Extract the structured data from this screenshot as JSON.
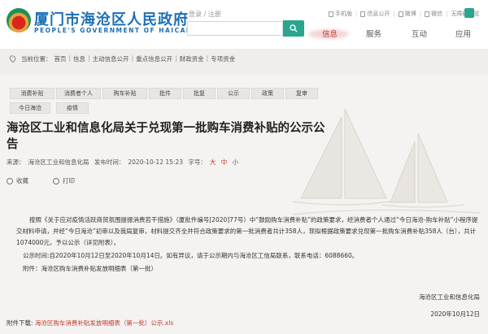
{
  "header": {
    "site_name_cn": "厦门市海沧区人民政府",
    "site_name_en": "PEOPLE'S GOVERNMENT OF HAICANG XIAMEN",
    "login_links": "登录 / 注册",
    "search": {
      "placeholder": ""
    },
    "utility": [
      "手机版",
      "信息公开",
      "微博",
      "微信",
      "无障碍浏览"
    ],
    "nav": [
      "信息",
      "服务",
      "互动",
      "应用"
    ],
    "nav_active": "信息"
  },
  "breadcrumb": {
    "prefix": "当前位置：",
    "items": [
      "首页",
      "信息",
      "主动信息公开",
      "重点信息公开",
      "财政资金",
      "专项资金"
    ]
  },
  "tags": [
    "消费补贴",
    "消费者个人",
    "购车补贴",
    "批件",
    "批复",
    "公示",
    "政策",
    "复审",
    "今日海沧",
    "疫情"
  ],
  "article": {
    "title": "海沧区工业和信息化局关于兑现第一批购车消费补贴的公示公告",
    "source_label": "来源：",
    "source": "海沧区工业和信息化局",
    "date_label": "发布时间：",
    "date": "2020-10-12 15:23",
    "font_label": "字号：",
    "font_big": "大",
    "font_mid": "中",
    "font_small": "小",
    "collect": "收藏",
    "print": "打印",
    "paragraphs": [
      "按照《关于应对疫情活跃商贸氛围提振消费若干措施》（厦批件编号[2020]77号）中“鼓励购车消费补贴”的政策要求，经消费者个人通过“今日海沧-购车补贴”小程序提交材料申请，并经“今日海沧”初审以及我局复审，材料提交齐全并符合政策要求的第一批消费者共计358人，现拟根据政策要求兑现第一批购车消费补贴358人（台），共计1074000元，予以公示（详见附表）。",
      "公示时间:自2020年10月12日至2020年10月14日。如有异议，请于公示期内与海沧区工信局联系，联系电话：6088660。",
      "附件：海沧区购车消费补贴发放明细表（第一批）"
    ],
    "signature_org": "海沧区工业和信息化局",
    "signature_date": "2020年10月12日"
  },
  "attachment": {
    "label": "附件下载:",
    "file": "海沧区购车消费补贴发放明细表（第一批）公示.xls"
  },
  "colors": {
    "brand_blue": "#1e6fb4",
    "accent_green": "#2aa58e",
    "accent_red": "#c0392b"
  }
}
